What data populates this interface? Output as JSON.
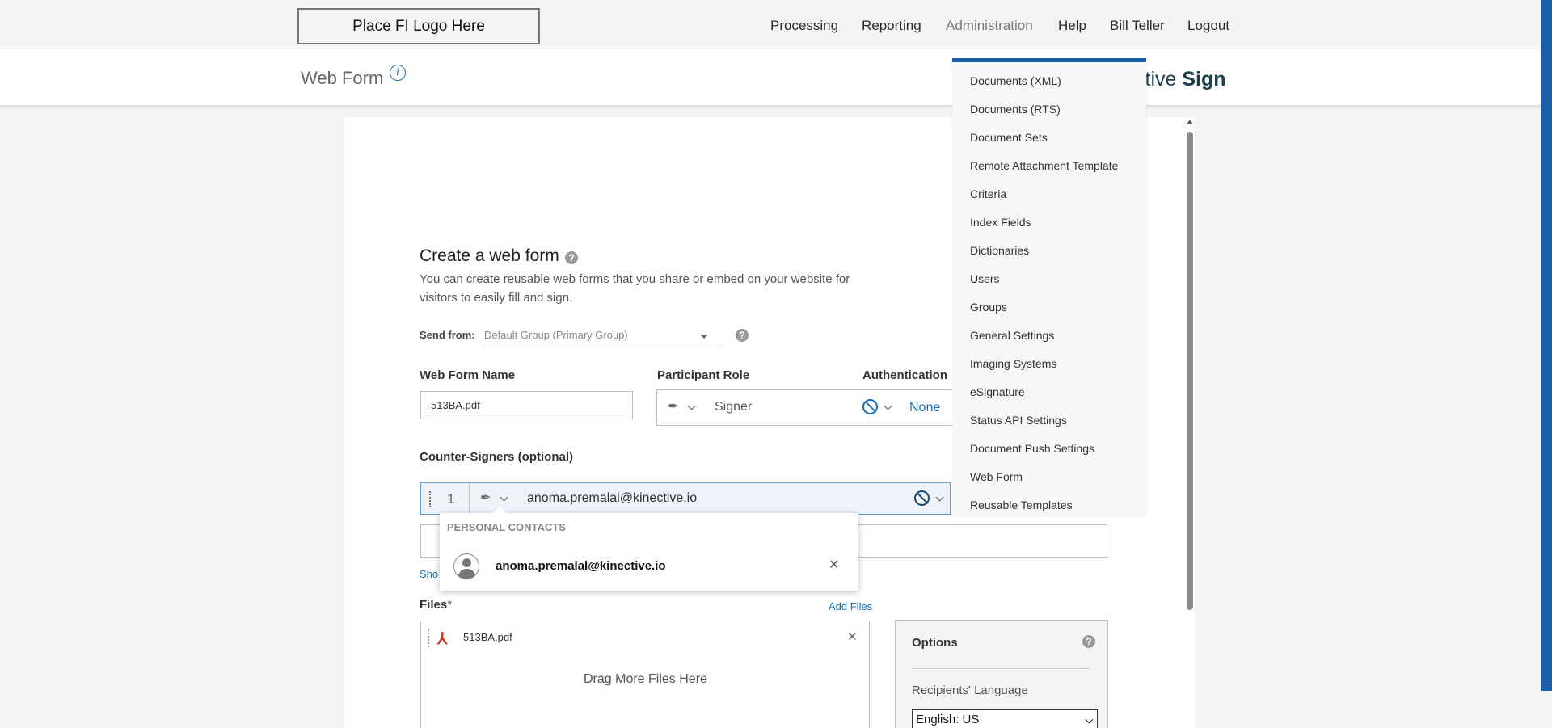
{
  "header": {
    "logo_placeholder": "Place FI Logo Here",
    "nav": [
      "Processing",
      "Reporting",
      "Administration",
      "Help",
      "Bill Teller",
      "Logout"
    ]
  },
  "subheader": {
    "title": "Web Form",
    "brand_partial": "ctive",
    "brand_bold": "Sign"
  },
  "form": {
    "heading": "Create a web form",
    "description": "You can create reusable web forms that you share or embed on your website for visitors to easily fill and sign.",
    "send_from_label": "Send from:",
    "send_from_value": "Default Group (Primary Group)",
    "web_form_name_label": "Web Form Name",
    "web_form_name_value": "513BA.pdf",
    "participant_role_label": "Participant Role",
    "participant_role_value": "Signer",
    "authentication_label": "Authentication F",
    "authentication_value": "None",
    "counter_signers_label": "Counter-Signers (optional)",
    "counter_signer_number": "1",
    "counter_signer_email": "anoma.premalal@kinective.io",
    "show_link": "Sho",
    "files_label": "Files",
    "files_required": "*",
    "add_files": "Add Files",
    "file_name": "513BA.pdf",
    "drop_text": "Drag More Files Here"
  },
  "contacts_popup": {
    "header": "PERSONAL CONTACTS",
    "email": "anoma.premalal@kinective.io"
  },
  "options": {
    "title": "Options",
    "language_label": "Recipients' Language",
    "language_value": "English: US"
  },
  "admin_menu": {
    "items": [
      "Documents (XML)",
      "Documents (RTS)",
      "Document Sets",
      "Remote Attachment Template",
      "Criteria",
      "Index Fields",
      "Dictionaries",
      "Users",
      "Groups",
      "General Settings",
      "Imaging Systems",
      "eSignature",
      "Status API Settings",
      "Document Push Settings",
      "Web Form",
      "Reusable Templates"
    ]
  },
  "colors": {
    "accent": "#1b6fb5",
    "menu_border": "#1a5fa8",
    "brand": "#1c3f4f"
  }
}
